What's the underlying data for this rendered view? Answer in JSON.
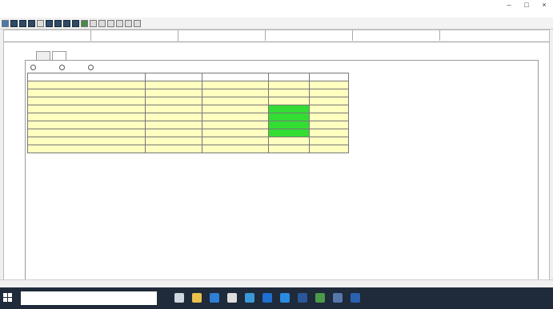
{
  "window": {
    "title": "",
    "controls": [
      "–",
      "□",
      "×"
    ]
  },
  "menu": {
    "items": []
  },
  "tabs": [
    {
      "label": ""
    },
    {
      "label": ""
    },
    {
      "label": ""
    },
    {
      "label": ""
    },
    {
      "label": ""
    }
  ],
  "sublabel": "",
  "subtabs": [
    {
      "label": ""
    },
    {
      "label": ""
    }
  ],
  "options": [
    {
      "label": ""
    },
    {
      "label": ""
    },
    {
      "label": ""
    }
  ],
  "table": {
    "headers": [
      "",
      "",
      "",
      "",
      ""
    ],
    "rows": [
      {
        "name": "",
        "value": "",
        "param": "",
        "error": "",
        "tol": "",
        "green": false
      },
      {
        "name": "",
        "value": "",
        "param": "",
        "error": "",
        "tol": "",
        "green": false
      },
      {
        "name": "",
        "value": "",
        "param": "",
        "error": "",
        "tol": "",
        "green": false
      },
      {
        "name": "",
        "value": "",
        "param": "",
        "error": "",
        "tol": "",
        "green": true
      },
      {
        "name": "",
        "value": "",
        "param": "",
        "error": "",
        "tol": "",
        "green": true
      },
      {
        "name": "",
        "value": "",
        "param": "",
        "error": "",
        "tol": "",
        "green": true
      },
      {
        "name": "",
        "value": "",
        "param": "",
        "error": "",
        "tol": "",
        "green": true
      },
      {
        "name": "",
        "value": "",
        "param": "",
        "error": "",
        "tol": "",
        "green": false
      },
      {
        "name": "",
        "value": "",
        "param": "",
        "error": "",
        "tol": "",
        "green": false
      }
    ]
  },
  "notes": [
    "",
    ""
  ],
  "status": [
    "",
    "",
    ""
  ],
  "taskbar": {
    "search_placeholder": "",
    "time": "",
    "date": ""
  }
}
